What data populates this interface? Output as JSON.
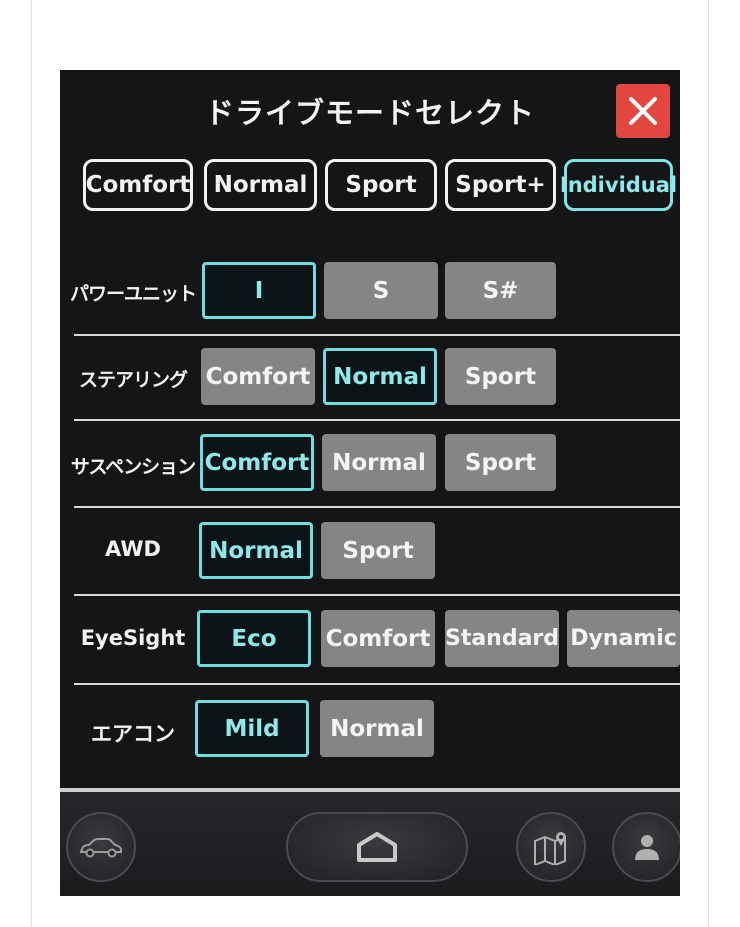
{
  "title": "ドライブモードセレクト",
  "modes": [
    {
      "label": "Comfort",
      "active": false
    },
    {
      "label": "Normal",
      "active": false
    },
    {
      "label": "Sport",
      "active": false
    },
    {
      "label": "Sport+",
      "active": false
    },
    {
      "label": "Individual",
      "active": true
    }
  ],
  "rows": [
    {
      "label": "パワーユニット",
      "options": [
        "I",
        "S",
        "S#"
      ],
      "selected": "I"
    },
    {
      "label": "ステアリング",
      "options": [
        "Comfort",
        "Normal",
        "Sport"
      ],
      "selected": "Normal"
    },
    {
      "label": "サスペンション",
      "options": [
        "Comfort",
        "Normal",
        "Sport"
      ],
      "selected": "Comfort"
    },
    {
      "label": "AWD",
      "options": [
        "Normal",
        "Sport"
      ],
      "selected": "Normal"
    },
    {
      "label": "EyeSight",
      "options": [
        "Eco",
        "Comfort",
        "Standard",
        "Dynamic"
      ],
      "selected": "Eco"
    },
    {
      "label": "エアコン",
      "options": [
        "Mild",
        "Normal"
      ],
      "selected": "Mild"
    }
  ],
  "icons": {
    "close": "close-icon",
    "car": "car-icon",
    "home": "home-icon",
    "map": "map-icon",
    "profile": "profile-icon"
  },
  "colors": {
    "accent": "#7fe3e6",
    "close_bg": "#e2463f",
    "option_bg": "#858585",
    "screen_bg": "#141517"
  }
}
